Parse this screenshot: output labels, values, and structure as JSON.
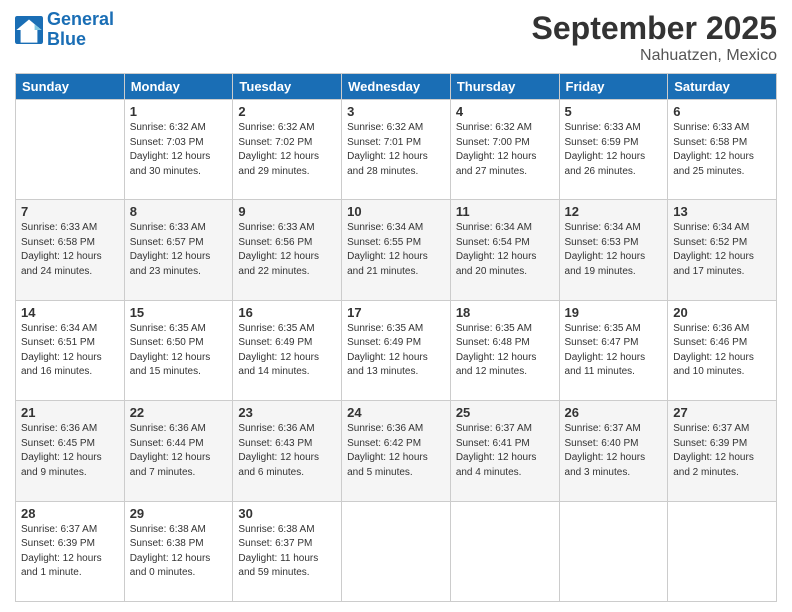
{
  "header": {
    "logo_general": "General",
    "logo_blue": "Blue",
    "month": "September 2025",
    "location": "Nahuatzen, Mexico"
  },
  "weekdays": [
    "Sunday",
    "Monday",
    "Tuesday",
    "Wednesday",
    "Thursday",
    "Friday",
    "Saturday"
  ],
  "weeks": [
    [
      {
        "day": "",
        "info": ""
      },
      {
        "day": "1",
        "info": "Sunrise: 6:32 AM\nSunset: 7:03 PM\nDaylight: 12 hours\nand 30 minutes."
      },
      {
        "day": "2",
        "info": "Sunrise: 6:32 AM\nSunset: 7:02 PM\nDaylight: 12 hours\nand 29 minutes."
      },
      {
        "day": "3",
        "info": "Sunrise: 6:32 AM\nSunset: 7:01 PM\nDaylight: 12 hours\nand 28 minutes."
      },
      {
        "day": "4",
        "info": "Sunrise: 6:32 AM\nSunset: 7:00 PM\nDaylight: 12 hours\nand 27 minutes."
      },
      {
        "day": "5",
        "info": "Sunrise: 6:33 AM\nSunset: 6:59 PM\nDaylight: 12 hours\nand 26 minutes."
      },
      {
        "day": "6",
        "info": "Sunrise: 6:33 AM\nSunset: 6:58 PM\nDaylight: 12 hours\nand 25 minutes."
      }
    ],
    [
      {
        "day": "7",
        "info": "Sunrise: 6:33 AM\nSunset: 6:58 PM\nDaylight: 12 hours\nand 24 minutes."
      },
      {
        "day": "8",
        "info": "Sunrise: 6:33 AM\nSunset: 6:57 PM\nDaylight: 12 hours\nand 23 minutes."
      },
      {
        "day": "9",
        "info": "Sunrise: 6:33 AM\nSunset: 6:56 PM\nDaylight: 12 hours\nand 22 minutes."
      },
      {
        "day": "10",
        "info": "Sunrise: 6:34 AM\nSunset: 6:55 PM\nDaylight: 12 hours\nand 21 minutes."
      },
      {
        "day": "11",
        "info": "Sunrise: 6:34 AM\nSunset: 6:54 PM\nDaylight: 12 hours\nand 20 minutes."
      },
      {
        "day": "12",
        "info": "Sunrise: 6:34 AM\nSunset: 6:53 PM\nDaylight: 12 hours\nand 19 minutes."
      },
      {
        "day": "13",
        "info": "Sunrise: 6:34 AM\nSunset: 6:52 PM\nDaylight: 12 hours\nand 17 minutes."
      }
    ],
    [
      {
        "day": "14",
        "info": "Sunrise: 6:34 AM\nSunset: 6:51 PM\nDaylight: 12 hours\nand 16 minutes."
      },
      {
        "day": "15",
        "info": "Sunrise: 6:35 AM\nSunset: 6:50 PM\nDaylight: 12 hours\nand 15 minutes."
      },
      {
        "day": "16",
        "info": "Sunrise: 6:35 AM\nSunset: 6:49 PM\nDaylight: 12 hours\nand 14 minutes."
      },
      {
        "day": "17",
        "info": "Sunrise: 6:35 AM\nSunset: 6:49 PM\nDaylight: 12 hours\nand 13 minutes."
      },
      {
        "day": "18",
        "info": "Sunrise: 6:35 AM\nSunset: 6:48 PM\nDaylight: 12 hours\nand 12 minutes."
      },
      {
        "day": "19",
        "info": "Sunrise: 6:35 AM\nSunset: 6:47 PM\nDaylight: 12 hours\nand 11 minutes."
      },
      {
        "day": "20",
        "info": "Sunrise: 6:36 AM\nSunset: 6:46 PM\nDaylight: 12 hours\nand 10 minutes."
      }
    ],
    [
      {
        "day": "21",
        "info": "Sunrise: 6:36 AM\nSunset: 6:45 PM\nDaylight: 12 hours\nand 9 minutes."
      },
      {
        "day": "22",
        "info": "Sunrise: 6:36 AM\nSunset: 6:44 PM\nDaylight: 12 hours\nand 7 minutes."
      },
      {
        "day": "23",
        "info": "Sunrise: 6:36 AM\nSunset: 6:43 PM\nDaylight: 12 hours\nand 6 minutes."
      },
      {
        "day": "24",
        "info": "Sunrise: 6:36 AM\nSunset: 6:42 PM\nDaylight: 12 hours\nand 5 minutes."
      },
      {
        "day": "25",
        "info": "Sunrise: 6:37 AM\nSunset: 6:41 PM\nDaylight: 12 hours\nand 4 minutes."
      },
      {
        "day": "26",
        "info": "Sunrise: 6:37 AM\nSunset: 6:40 PM\nDaylight: 12 hours\nand 3 minutes."
      },
      {
        "day": "27",
        "info": "Sunrise: 6:37 AM\nSunset: 6:39 PM\nDaylight: 12 hours\nand 2 minutes."
      }
    ],
    [
      {
        "day": "28",
        "info": "Sunrise: 6:37 AM\nSunset: 6:39 PM\nDaylight: 12 hours\nand 1 minute."
      },
      {
        "day": "29",
        "info": "Sunrise: 6:38 AM\nSunset: 6:38 PM\nDaylight: 12 hours\nand 0 minutes."
      },
      {
        "day": "30",
        "info": "Sunrise: 6:38 AM\nSunset: 6:37 PM\nDaylight: 11 hours\nand 59 minutes."
      },
      {
        "day": "",
        "info": ""
      },
      {
        "day": "",
        "info": ""
      },
      {
        "day": "",
        "info": ""
      },
      {
        "day": "",
        "info": ""
      }
    ]
  ]
}
